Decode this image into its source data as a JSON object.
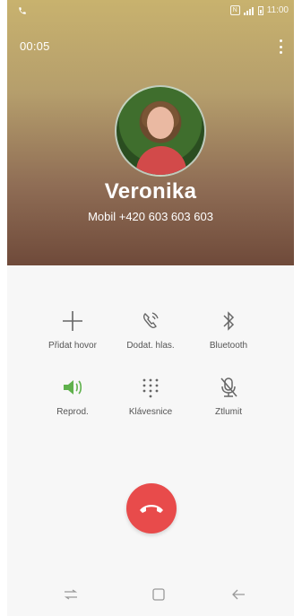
{
  "status_bar": {
    "time": "11:00",
    "network_label": "N"
  },
  "call": {
    "timer": "00:05",
    "caller_name": "Veronika",
    "caller_info": "Mobil  +420 603 603 603"
  },
  "actions": [
    {
      "label": "Přidat hovor",
      "icon": "plus-icon"
    },
    {
      "label": "Dodat. hlas.",
      "icon": "voicemail-icon"
    },
    {
      "label": "Bluetooth",
      "icon": "bluetooth-icon"
    },
    {
      "label": "Reprod.",
      "icon": "speaker-icon",
      "active_color": "#5fb14c"
    },
    {
      "label": "Klávesnice",
      "icon": "keypad-icon"
    },
    {
      "label": "Ztlumit",
      "icon": "mute-icon"
    }
  ],
  "end_call": {
    "icon": "end-call-icon",
    "color": "#e84b4b"
  },
  "navbar": [
    "recent-apps-icon",
    "home-icon",
    "back-icon"
  ]
}
